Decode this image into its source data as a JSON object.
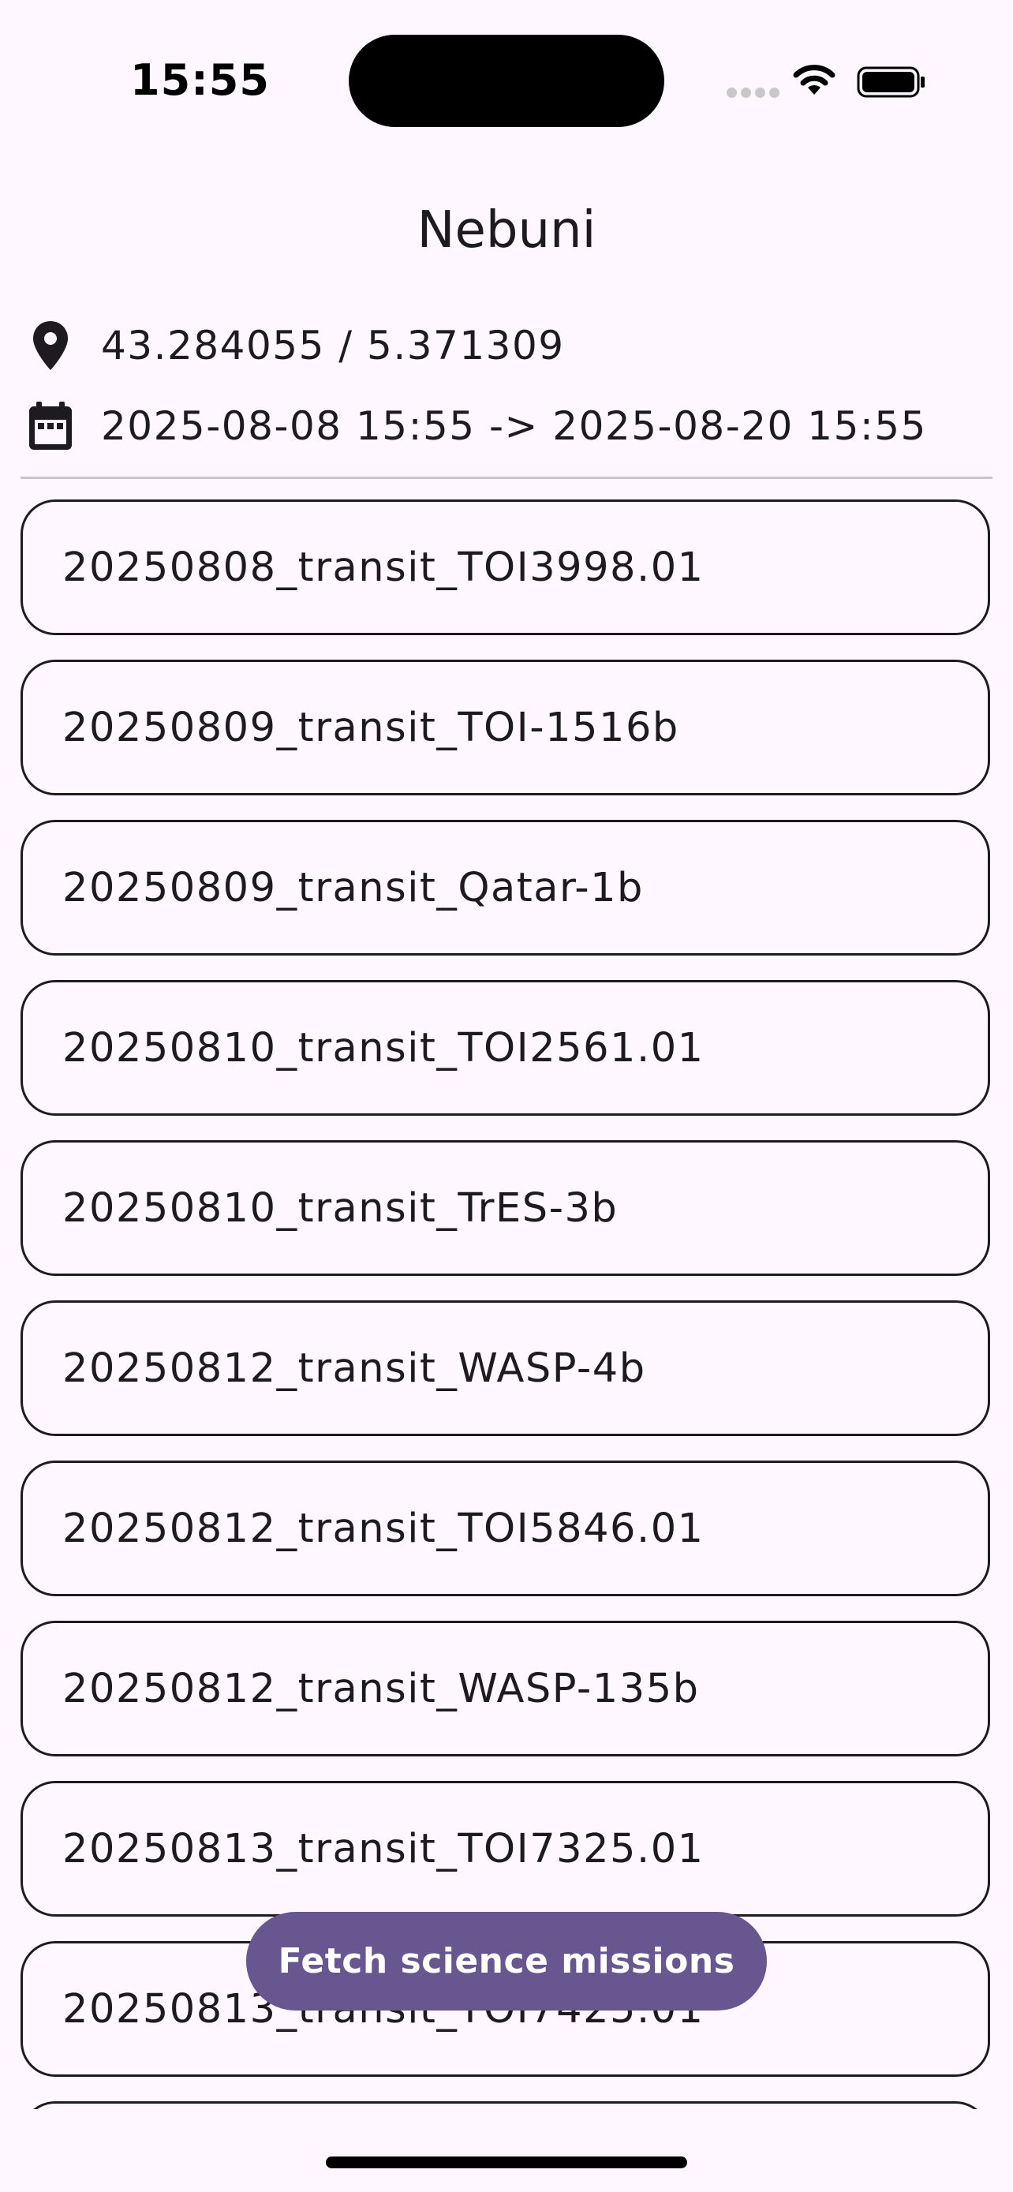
{
  "status_bar": {
    "time": "15:55",
    "icons": [
      "cellular-signal-icon",
      "wifi-icon",
      "battery-icon"
    ]
  },
  "app_bar": {
    "title": "Nebuni"
  },
  "location": {
    "icon": "location-pin-icon",
    "text": "43.284055 / 5.371309"
  },
  "date_range": {
    "icon": "calendar-icon",
    "text": "2025-08-08 15:55 -> 2025-08-20 15:55"
  },
  "missions": [
    {
      "label": "20250808_transit_TOI3998.01"
    },
    {
      "label": "20250809_transit_TOI-1516b"
    },
    {
      "label": "20250809_transit_Qatar-1b"
    },
    {
      "label": "20250810_transit_TOI2561.01"
    },
    {
      "label": "20250810_transit_TrES-3b"
    },
    {
      "label": "20250812_transit_WASP-4b"
    },
    {
      "label": "20250812_transit_TOI5846.01"
    },
    {
      "label": "20250812_transit_WASP-135b"
    },
    {
      "label": "20250813_transit_TOI7325.01"
    },
    {
      "label": "20250813_transit_TOI7425.01"
    },
    {
      "label": ""
    }
  ],
  "fab": {
    "label": "Fetch science missions"
  },
  "colors": {
    "background": "#FEF7FF",
    "text": "#1D1B20",
    "card_border": "#1D1B20",
    "divider": "#CAC4D0",
    "button": "#67568F",
    "button_text": "#FFFFFF"
  }
}
